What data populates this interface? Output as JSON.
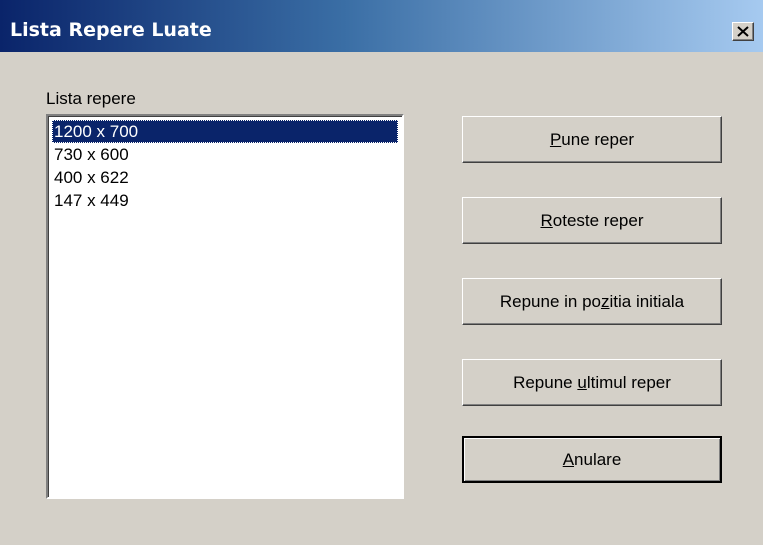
{
  "window": {
    "title": "Lista Repere Luate"
  },
  "list": {
    "label": "Lista repere",
    "items": [
      "1200 x 700",
      "730 x 600",
      "400 x 622",
      "147 x 449"
    ],
    "selected_index": 0
  },
  "buttons": {
    "pune": {
      "pre": "",
      "accel": "P",
      "post": "une reper"
    },
    "roteste": {
      "pre": "",
      "accel": "R",
      "post": "oteste reper"
    },
    "repune_pozitia": {
      "pre": "Repune in po",
      "accel": "z",
      "post": "itia initiala"
    },
    "repune_ultimul": {
      "pre": "Repune ",
      "accel": "u",
      "post": "ltimul reper"
    },
    "anulare": {
      "pre": "",
      "accel": "A",
      "post": "nulare"
    }
  },
  "colors": {
    "face": "#d4d0c8",
    "title_start": "#0a246a",
    "title_end": "#a6caf0",
    "selection": "#0a246a"
  }
}
